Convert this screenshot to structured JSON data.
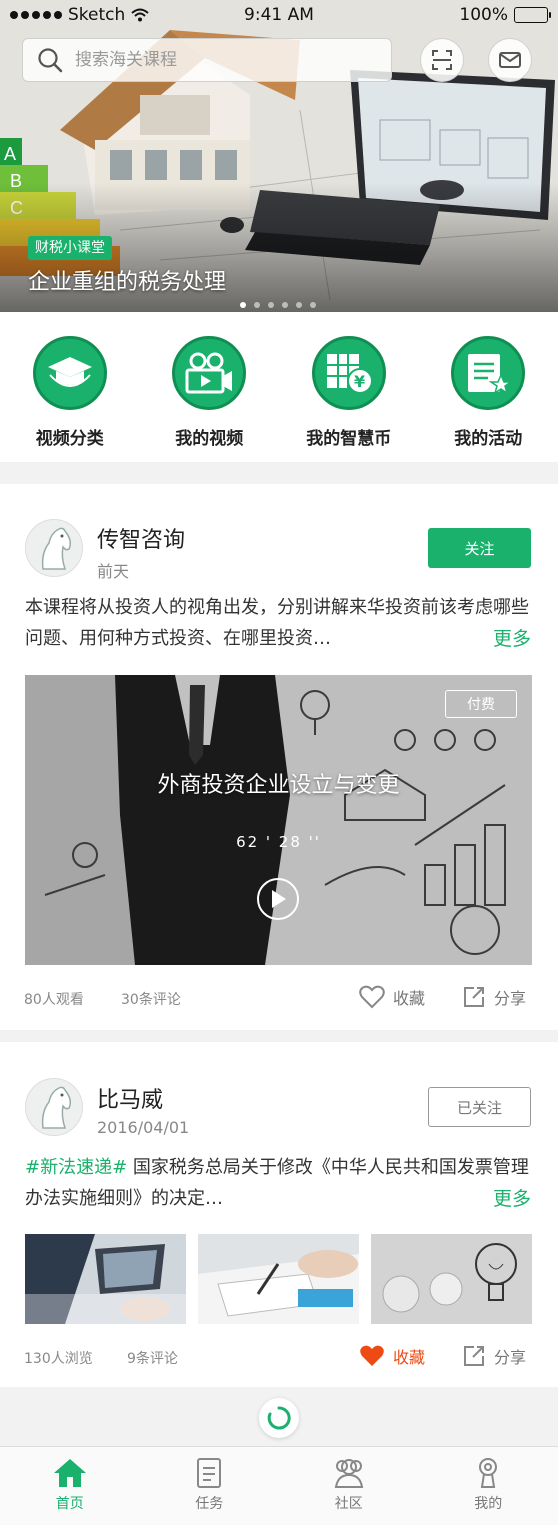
{
  "status_bar": {
    "carrier": "Sketch",
    "time": "9:41 AM",
    "battery": "100%"
  },
  "search": {
    "placeholder": "搜索海关课程"
  },
  "banner": {
    "tag": "财税小课堂",
    "title": "企业重组的税务处理",
    "slide_count": 6,
    "active_slide": 0
  },
  "nav": [
    {
      "label": "视频分类",
      "icon": "graduation-cap-icon"
    },
    {
      "label": "我的视频",
      "icon": "video-camera-icon"
    },
    {
      "label": "我的智慧币",
      "icon": "coin-icon"
    },
    {
      "label": "我的活动",
      "icon": "activity-star-icon"
    }
  ],
  "posts": [
    {
      "author": "传智咨询",
      "time": "前天",
      "follow_label": "关注",
      "text": "本课程将从投资人的视角出发，分别讲解来华投资前该考虑哪些问题、用何种方式投资、在哪里投资…",
      "more_label": "更多",
      "video": {
        "title": "外商投资企业设立与变更",
        "duration": "62 ' 28 ''",
        "badge": "付费"
      },
      "views": "80人观看",
      "comments": "30条评论",
      "favorite_label": "收藏",
      "share_label": "分享"
    },
    {
      "author": "比马威",
      "time": "2016/04/01",
      "follow_label": "已关注",
      "hashtag": "#新法速递#",
      "text": " 国家税务总局关于修改《中华人民共和国发票管理办法实施细则》的决定…",
      "more_label": "更多",
      "views": "130人浏览",
      "comments": "9条评论",
      "favorite_label": "收藏",
      "share_label": "分享"
    }
  ],
  "tabs": [
    {
      "label": "首页",
      "icon": "home-icon",
      "active": true
    },
    {
      "label": "任务",
      "icon": "task-icon",
      "active": false
    },
    {
      "label": "社区",
      "icon": "community-icon",
      "active": false
    },
    {
      "label": "我的",
      "icon": "profile-icon",
      "active": false
    }
  ],
  "colors": {
    "accent": "#19b16b",
    "liked": "#ee4b14",
    "muted": "#888888"
  }
}
